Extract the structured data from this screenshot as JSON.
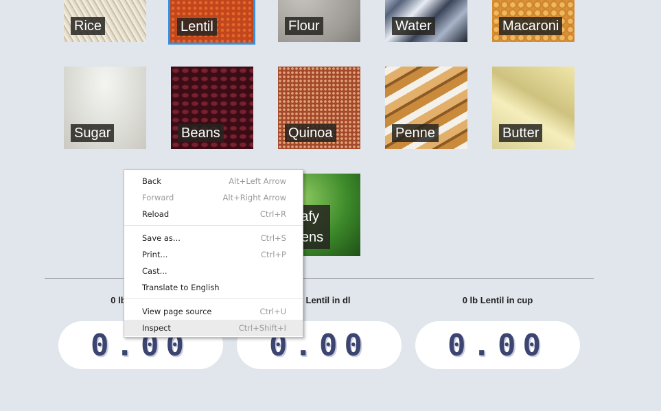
{
  "foods": [
    {
      "label": "Rice"
    },
    {
      "label": "Lentil"
    },
    {
      "label": "Flour"
    },
    {
      "label": "Water"
    },
    {
      "label": "Macaroni"
    },
    {
      "label": "Sugar"
    },
    {
      "label": "Beans"
    },
    {
      "label": "Quinoa"
    },
    {
      "label": "Penne"
    },
    {
      "label": "Butter"
    },
    {
      "label": "Leafy",
      "label2": "greens"
    }
  ],
  "selected_food": "Lentil",
  "conversions": [
    {
      "label": "0 lb Lentil in g",
      "value": "0.00"
    },
    {
      "label": "0 lb Lentil in dl",
      "value": "0.00"
    },
    {
      "label": "0 lb Lentil in cup",
      "value": "0.00"
    }
  ],
  "context_menu": {
    "items": [
      {
        "label": "Back",
        "shortcut": "Alt+Left Arrow",
        "enabled": true
      },
      {
        "label": "Forward",
        "shortcut": "Alt+Right Arrow",
        "enabled": false
      },
      {
        "label": "Reload",
        "shortcut": "Ctrl+R",
        "enabled": true
      },
      {
        "label": "Save as...",
        "shortcut": "Ctrl+S",
        "enabled": true
      },
      {
        "label": "Print...",
        "shortcut": "Ctrl+P",
        "enabled": true
      },
      {
        "label": "Cast...",
        "shortcut": "",
        "enabled": true
      },
      {
        "label": "Translate to English",
        "shortcut": "",
        "enabled": true
      },
      {
        "label": "View page source",
        "shortcut": "Ctrl+U",
        "enabled": true
      },
      {
        "label": "Inspect",
        "shortcut": "Ctrl+Shift+I",
        "enabled": true,
        "highlighted": true
      }
    ]
  },
  "colors": {
    "page_bg": "#e1e5ec",
    "selected_border": "#3391e3",
    "digit_color": "#3b4570"
  }
}
